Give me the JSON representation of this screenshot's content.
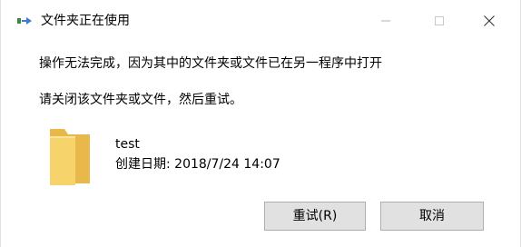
{
  "window": {
    "title": "文件夹正在使用",
    "icons": {
      "app": "folder-in-use-icon",
      "minimize": "minimize-icon",
      "maximize": "maximize-icon",
      "close": "close-icon"
    }
  },
  "dialog": {
    "message": "操作无法完成，因为其中的文件夹或文件已在另一程序中打开",
    "prompt": "请关闭该文件夹或文件，然后重试。",
    "item": {
      "icon": "folder-icon",
      "name": "test",
      "created": "创建日期: 2018/7/24 14:07"
    }
  },
  "buttons": {
    "retry": "重试(R)",
    "cancel": "取消"
  },
  "colors": {
    "folder": "#f5cd5f",
    "folder_light": "#ffe28a",
    "button_bg": "#e1e1e1",
    "button_border": "#adadad"
  }
}
